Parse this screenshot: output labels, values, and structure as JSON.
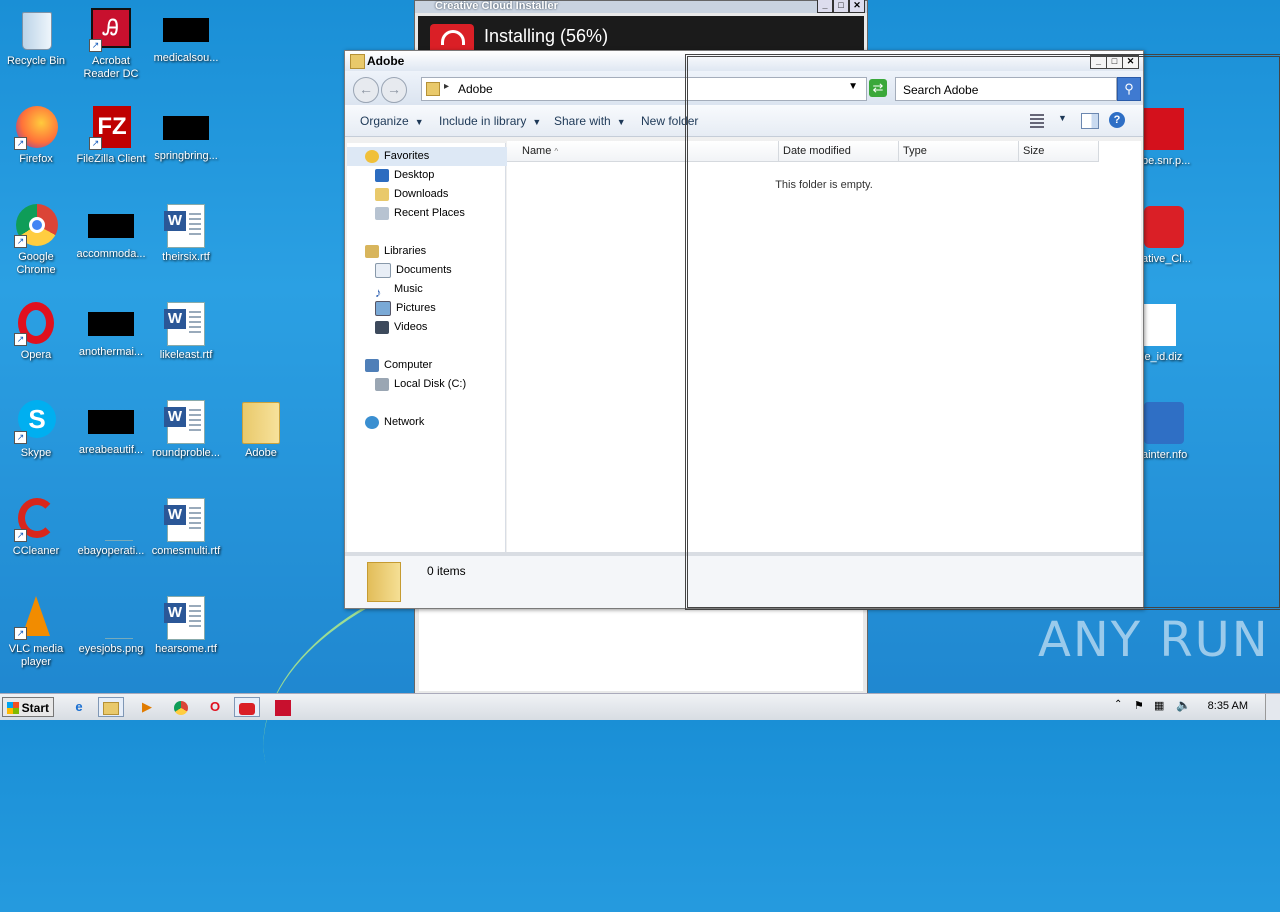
{
  "desktop": {
    "icons_col1": [
      "Recycle Bin",
      "Acrobat Reader DC",
      "medicalsou...",
      "Firefox",
      "FileZilla Client",
      "springbring...",
      "Google Chrome",
      "accommoda...",
      "theirsix.rtf",
      "Opera",
      "anothermai...",
      "likeleast.rtf",
      "Skype",
      "areabeautif...",
      "roundproble...",
      "Adobe",
      "CCleaner",
      "ebayoperati...",
      "comesmulti.rtf",
      "VLC media player",
      "eyesjobs.png",
      "hearsome.rtf"
    ],
    "right_icons": [
      "be.snr.p...",
      "ative_Cl...",
      "le_id.diz",
      "ainter.nfo"
    ]
  },
  "cc_installer": {
    "title": "Creative Cloud Installer",
    "status": "Installing (56%)",
    "progress_percent": 56
  },
  "explorer": {
    "title": "Adobe",
    "address_path": "Adobe",
    "search_placeholder": "Search Adobe",
    "toolbar": {
      "organize": "Organize",
      "include_in_library": "Include in library",
      "share_with": "Share with",
      "new_folder": "New folder"
    },
    "nav": {
      "favorites": "Favorites",
      "desktop": "Desktop",
      "downloads": "Downloads",
      "recent_places": "Recent Places",
      "libraries": "Libraries",
      "documents": "Documents",
      "music": "Music",
      "pictures": "Pictures",
      "videos": "Videos",
      "computer": "Computer",
      "local_disk": "Local Disk (C:)",
      "network": "Network"
    },
    "columns": {
      "name": "Name",
      "date_modified": "Date modified",
      "type": "Type",
      "size": "Size"
    },
    "empty_message": "This folder is empty.",
    "status_count": "0 items"
  },
  "taskbar": {
    "start_label": "Start",
    "clock": "8:35 AM"
  },
  "watermark": "ANY RUN"
}
